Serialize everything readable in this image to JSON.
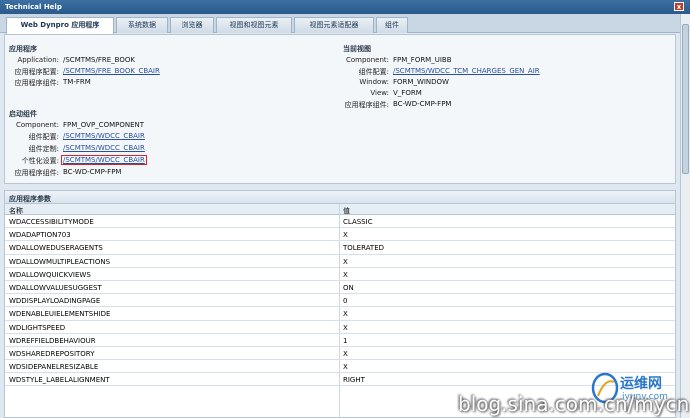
{
  "window": {
    "title": "Technical Help",
    "close_glyph": "x"
  },
  "tabs": [
    "Web Dynpro 应用程序",
    "系统数据",
    "浏览器",
    "视图和视图元素",
    "视图元素适配器",
    "组件"
  ],
  "app_section": {
    "title": "应用程序",
    "rows": [
      {
        "label": "Application:",
        "value": "/SCMTMS/FRE_BOOK"
      },
      {
        "label": "应用程序配置:",
        "value": "/SCMTMS/FRE_BOOK_CBAIR"
      },
      {
        "label": "应用程序组件:",
        "value": "TM-FRM"
      }
    ]
  },
  "view_section": {
    "title": "当前视图",
    "rows": [
      {
        "label": "Component:",
        "value": "FPM_FORM_UIBB"
      },
      {
        "label": "组件配置:",
        "value": "/SCMTMS/WDCC_TCM_CHARGES_GEN_AIR"
      },
      {
        "label": "Window:",
        "value": "FORM_WINDOW"
      },
      {
        "label": "View:",
        "value": "V_FORM"
      },
      {
        "label": "应用程序组件:",
        "value": "BC-WD-CMP-FPM"
      }
    ]
  },
  "start_section": {
    "title": "启动组件",
    "rows": [
      {
        "label": "Component:",
        "value": "FPM_OVP_COMPONENT"
      },
      {
        "label": "组件配置:",
        "value": "/SCMTMS/WDCC_CBAIR"
      },
      {
        "label": "组件定制:",
        "value": "/SCMTMS/WDCC_CBAIR"
      },
      {
        "label": "个性化设置:",
        "value": "/SCMTMS/WDCC_CBAIR"
      },
      {
        "label": "应用程序组件:",
        "value": "BC-WD-CMP-FPM"
      }
    ]
  },
  "params": {
    "title": "应用程序参数",
    "col_name": "名称",
    "col_value": "值",
    "rows": [
      {
        "name": "WDACCESSIBILITYMODE",
        "value": "CLASSIC"
      },
      {
        "name": "WDADAPTION703",
        "value": "X"
      },
      {
        "name": "WDALLOWEDUSERAGENTS",
        "value": "TOLERATED"
      },
      {
        "name": "WDALLOWMULTIPLEACTIONS",
        "value": "X"
      },
      {
        "name": "WDALLOWQUICKVIEWS",
        "value": "X"
      },
      {
        "name": "WDALLOWVALUESUGGEST",
        "value": "ON"
      },
      {
        "name": "WDDISPLAYLOADINGPAGE",
        "value": "0"
      },
      {
        "name": "WDENABLEUIELEMENTSHIDE",
        "value": "X"
      },
      {
        "name": "WDLIGHTSPEED",
        "value": "X"
      },
      {
        "name": "WDREFFIELDBEHAVIOUR",
        "value": "1"
      },
      {
        "name": "WDSHAREDREPOSITORY",
        "value": "X"
      },
      {
        "name": "WDSIDEPANELRESIZABLE",
        "value": "X"
      },
      {
        "name": "WDSTYLE_LABELALIGNMENT",
        "value": "RIGHT"
      }
    ]
  },
  "watermark": {
    "url": "blog.sina.com.cn/mycn",
    "logo_text": "运维网",
    "logo_sub": "iyunv.com"
  }
}
